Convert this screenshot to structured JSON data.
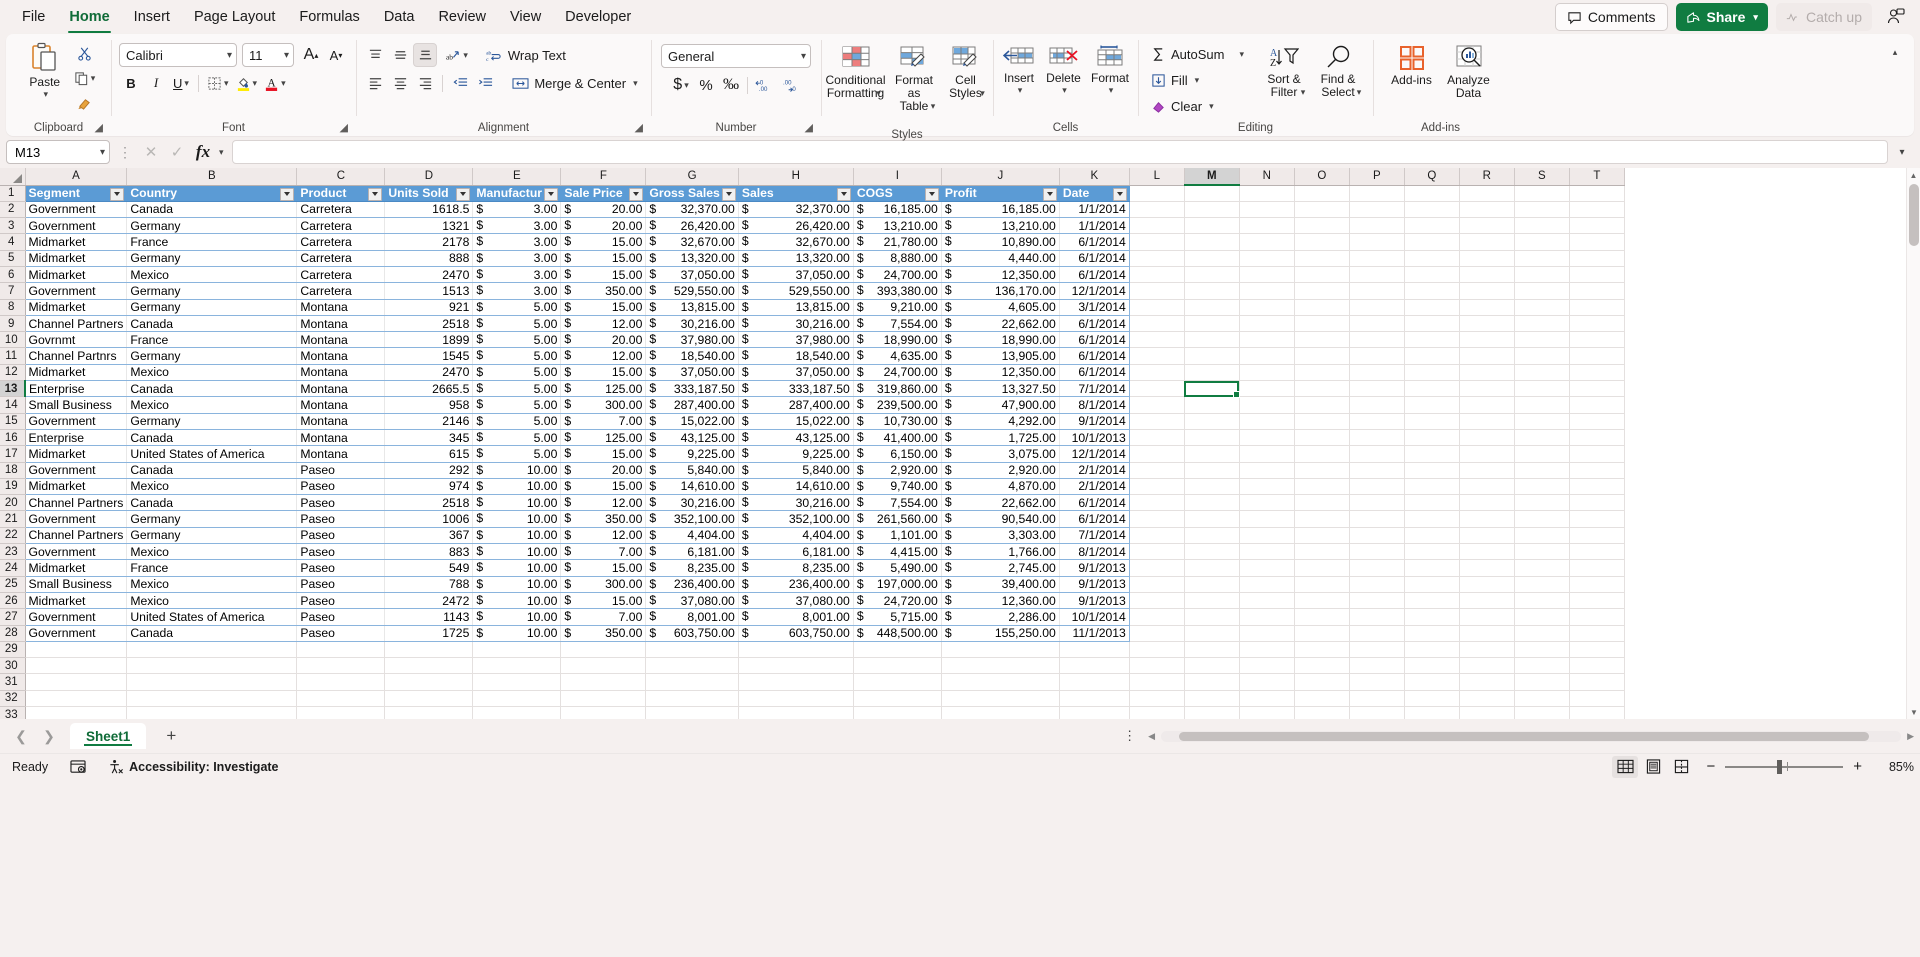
{
  "app": {
    "menu_tabs": [
      "File",
      "Home",
      "Insert",
      "Page Layout",
      "Formulas",
      "Data",
      "Review",
      "View",
      "Developer"
    ],
    "active_tab": "Home",
    "comments_label": "Comments",
    "share_label": "Share",
    "catchup_label": "Catch up",
    "accent_green": "#107c41"
  },
  "ribbon": {
    "clipboard": {
      "group_label": "Clipboard",
      "paste_label": "Paste",
      "cut_icon": "scissors-icon",
      "copy_icon": "copy-icon",
      "format_painter_icon": "format-painter-icon"
    },
    "font": {
      "group_label": "Font",
      "font_name": "Calibri",
      "font_size": "11",
      "grow_label": "A",
      "shrink_label": "A",
      "bold": "B",
      "italic": "I",
      "underline": "U",
      "borders_icon": "borders-icon",
      "fill_color_icon": "fill-color-icon",
      "font_color_icon": "font-color-icon"
    },
    "alignment": {
      "group_label": "Alignment",
      "wrap_text": "Wrap Text",
      "merge_center": "Merge & Center",
      "orientation_icon": "text-orientation-icon",
      "indent_decrease_icon": "decrease-indent-icon",
      "indent_increase_icon": "increase-indent-icon"
    },
    "number": {
      "group_label": "Number",
      "format": "General",
      "accounting": "$",
      "percent": "%",
      "comma": "‰",
      "decrease_decimal": ".00",
      "increase_decimal": ".00"
    },
    "styles": {
      "group_label": "Styles",
      "conditional_formatting": "Conditional Formatting",
      "format_as_table": "Format as Table",
      "cell_styles": "Cell Styles"
    },
    "cells": {
      "group_label": "Cells",
      "insert": "Insert",
      "delete": "Delete",
      "format": "Format"
    },
    "editing": {
      "group_label": "Editing",
      "autosum": "AutoSum",
      "fill": "Fill",
      "clear": "Clear",
      "sort_filter": "Sort & Filter",
      "find_select": "Find & Select"
    },
    "addins": {
      "group_label": "Add-ins",
      "addins": "Add-ins",
      "analyze_data": "Analyze Data"
    }
  },
  "formula_bar": {
    "name_box": "M13",
    "formula_value": "",
    "cancel_icon": "cancel-icon",
    "enter_icon": "enter-icon",
    "fx_icon": "insert-function-icon"
  },
  "grid": {
    "columns": [
      "A",
      "B",
      "C",
      "D",
      "E",
      "F",
      "G",
      "H",
      "I",
      "J",
      "K",
      "L",
      "M",
      "N",
      "O",
      "P",
      "Q",
      "R",
      "S",
      "T"
    ],
    "selected_column": "M",
    "selected_row": 13,
    "selected_cell": "M13",
    "row_numbers": [
      1,
      2,
      3,
      4,
      5,
      6,
      7,
      8,
      9,
      10,
      11,
      12,
      13,
      14,
      15,
      16,
      17,
      18,
      19,
      20,
      21,
      22,
      23,
      24,
      25,
      26,
      27,
      28,
      29,
      30,
      31,
      32,
      33
    ],
    "table_headers": [
      "Segment",
      "Country",
      "Product",
      "Units Sold",
      "Manufactur",
      "Sale Price",
      "Gross Sales",
      "Sales",
      "COGS",
      "Profit",
      "Date"
    ],
    "rows": [
      [
        "Government",
        "Canada",
        "Carretera",
        "1618.5",
        "3.00",
        "20.00",
        "32,370.00",
        "32,370.00",
        "16,185.00",
        "16,185.00",
        "1/1/2014"
      ],
      [
        "Government",
        "Germany",
        "Carretera",
        "1321",
        "3.00",
        "20.00",
        "26,420.00",
        "26,420.00",
        "13,210.00",
        "13,210.00",
        "1/1/2014"
      ],
      [
        "Midmarket",
        "France",
        "Carretera",
        "2178",
        "3.00",
        "15.00",
        "32,670.00",
        "32,670.00",
        "21,780.00",
        "10,890.00",
        "6/1/2014"
      ],
      [
        "Midmarket",
        "Germany",
        "Carretera",
        "888",
        "3.00",
        "15.00",
        "13,320.00",
        "13,320.00",
        "8,880.00",
        "4,440.00",
        "6/1/2014"
      ],
      [
        "Midmarket",
        "Mexico",
        "Carretera",
        "2470",
        "3.00",
        "15.00",
        "37,050.00",
        "37,050.00",
        "24,700.00",
        "12,350.00",
        "6/1/2014"
      ],
      [
        "Government",
        "Germany",
        "Carretera",
        "1513",
        "3.00",
        "350.00",
        "529,550.00",
        "529,550.00",
        "393,380.00",
        "136,170.00",
        "12/1/2014"
      ],
      [
        "Midmarket",
        "Germany",
        "Montana",
        "921",
        "5.00",
        "15.00",
        "13,815.00",
        "13,815.00",
        "9,210.00",
        "4,605.00",
        "3/1/2014"
      ],
      [
        "Channel Partners",
        "Canada",
        "Montana",
        "2518",
        "5.00",
        "12.00",
        "30,216.00",
        "30,216.00",
        "7,554.00",
        "22,662.00",
        "6/1/2014"
      ],
      [
        "Govrnmt",
        "France",
        "Montana",
        "1899",
        "5.00",
        "20.00",
        "37,980.00",
        "37,980.00",
        "18,990.00",
        "18,990.00",
        "6/1/2014"
      ],
      [
        "Channel Partnrs",
        "Germany",
        "Montana",
        "1545",
        "5.00",
        "12.00",
        "18,540.00",
        "18,540.00",
        "4,635.00",
        "13,905.00",
        "6/1/2014"
      ],
      [
        "Midmarket",
        "Mexico",
        "Montana",
        "2470",
        "5.00",
        "15.00",
        "37,050.00",
        "37,050.00",
        "24,700.00",
        "12,350.00",
        "6/1/2014"
      ],
      [
        "Enterprise",
        "Canada",
        "Montana",
        "2665.5",
        "5.00",
        "125.00",
        "333,187.50",
        "333,187.50",
        "319,860.00",
        "13,327.50",
        "7/1/2014"
      ],
      [
        "Small Business",
        "Mexico",
        "Montana",
        "958",
        "5.00",
        "300.00",
        "287,400.00",
        "287,400.00",
        "239,500.00",
        "47,900.00",
        "8/1/2014"
      ],
      [
        "Government",
        "Germany",
        "Montana",
        "2146",
        "5.00",
        "7.00",
        "15,022.00",
        "15,022.00",
        "10,730.00",
        "4,292.00",
        "9/1/2014"
      ],
      [
        "Enterprise",
        "Canada",
        "Montana",
        "345",
        "5.00",
        "125.00",
        "43,125.00",
        "43,125.00",
        "41,400.00",
        "1,725.00",
        "10/1/2013"
      ],
      [
        "Midmarket",
        "United States of America",
        "Montana",
        "615",
        "5.00",
        "15.00",
        "9,225.00",
        "9,225.00",
        "6,150.00",
        "3,075.00",
        "12/1/2014"
      ],
      [
        "Government",
        "Canada",
        "Paseo",
        "292",
        "10.00",
        "20.00",
        "5,840.00",
        "5,840.00",
        "2,920.00",
        "2,920.00",
        "2/1/2014"
      ],
      [
        "Midmarket",
        "Mexico",
        "Paseo",
        "974",
        "10.00",
        "15.00",
        "14,610.00",
        "14,610.00",
        "9,740.00",
        "4,870.00",
        "2/1/2014"
      ],
      [
        "Channel Partners",
        "Canada",
        "Paseo",
        "2518",
        "10.00",
        "12.00",
        "30,216.00",
        "30,216.00",
        "7,554.00",
        "22,662.00",
        "6/1/2014"
      ],
      [
        "Government",
        "Germany",
        "Paseo",
        "1006",
        "10.00",
        "350.00",
        "352,100.00",
        "352,100.00",
        "261,560.00",
        "90,540.00",
        "6/1/2014"
      ],
      [
        "Channel Partners",
        "Germany",
        "Paseo",
        "367",
        "10.00",
        "12.00",
        "4,404.00",
        "4,404.00",
        "1,101.00",
        "3,303.00",
        "7/1/2014"
      ],
      [
        "Government",
        "Mexico",
        "Paseo",
        "883",
        "10.00",
        "7.00",
        "6,181.00",
        "6,181.00",
        "4,415.00",
        "1,766.00",
        "8/1/2014"
      ],
      [
        "Midmarket",
        "France",
        "Paseo",
        "549",
        "10.00",
        "15.00",
        "8,235.00",
        "8,235.00",
        "5,490.00",
        "2,745.00",
        "9/1/2013"
      ],
      [
        "Small Business",
        "Mexico",
        "Paseo",
        "788",
        "10.00",
        "300.00",
        "236,400.00",
        "236,400.00",
        "197,000.00",
        "39,400.00",
        "9/1/2013"
      ],
      [
        "Midmarket",
        "Mexico",
        "Paseo",
        "2472",
        "10.00",
        "15.00",
        "37,080.00",
        "37,080.00",
        "24,720.00",
        "12,360.00",
        "9/1/2013"
      ],
      [
        "Government",
        "United States of America",
        "Paseo",
        "1143",
        "10.00",
        "7.00",
        "8,001.00",
        "8,001.00",
        "5,715.00",
        "2,286.00",
        "10/1/2014"
      ],
      [
        "Government",
        "Canada",
        "Paseo",
        "1725",
        "10.00",
        "350.00",
        "603,750.00",
        "603,750.00",
        "448,500.00",
        "155,250.00",
        "11/1/2013"
      ]
    ]
  },
  "sheet_bar": {
    "sheet_name": "Sheet1",
    "prev_icon": "chevron-left-icon",
    "next_icon": "chevron-right-icon",
    "add_sheet_icon": "add-sheet-icon"
  },
  "status_bar": {
    "state": "Ready",
    "accessibility": "Accessibility: Investigate",
    "recording_icon": "macro-record-icon",
    "accessibility_icon": "accessibility-icon",
    "view_normal_icon": "normal-view-icon",
    "view_pagelayout_icon": "page-layout-view-icon",
    "view_pagebreak_icon": "page-break-view-icon",
    "zoom_out": "−",
    "zoom_in": "+",
    "zoom_level": "85%"
  }
}
